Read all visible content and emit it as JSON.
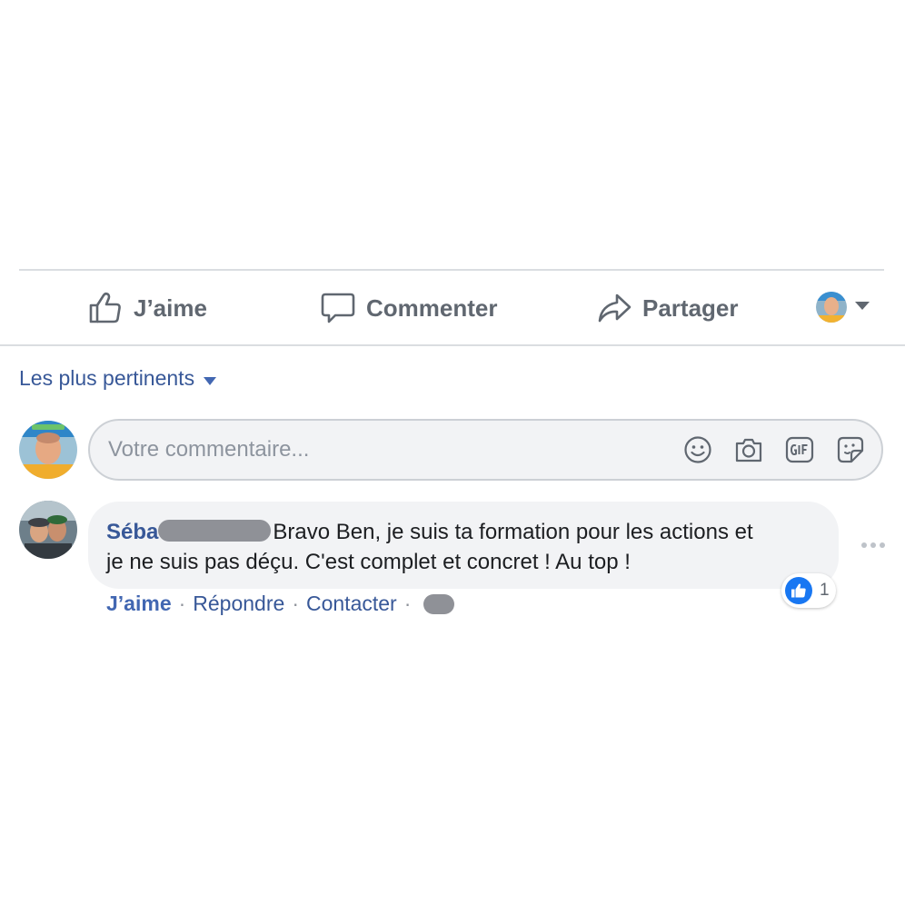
{
  "actions": {
    "like_label": "J’aime",
    "comment_label": "Commenter",
    "share_label": "Partager"
  },
  "sort": {
    "label": "Les plus pertinents"
  },
  "composer": {
    "placeholder": "Votre commentaire...",
    "icons": [
      "emoji-icon",
      "camera-icon",
      "gif-icon",
      "sticker-icon"
    ]
  },
  "comment": {
    "author": "Séba",
    "text_line1": "Bravo Ben, je suis ta formation pour les actions et",
    "text_line2": "je ne suis pas déçu. C'est complet et concret ! Au top !",
    "reaction_count": "1",
    "actions": {
      "like": "J’aime",
      "reply": "Répondre",
      "contact": "Contacter",
      "separator": "·"
    }
  },
  "colors": {
    "link_blue": "#385898",
    "like_blue": "#1877f2",
    "icon_gray": "#606770",
    "bubble_bg": "#f2f3f5",
    "divider": "#dadde1"
  }
}
